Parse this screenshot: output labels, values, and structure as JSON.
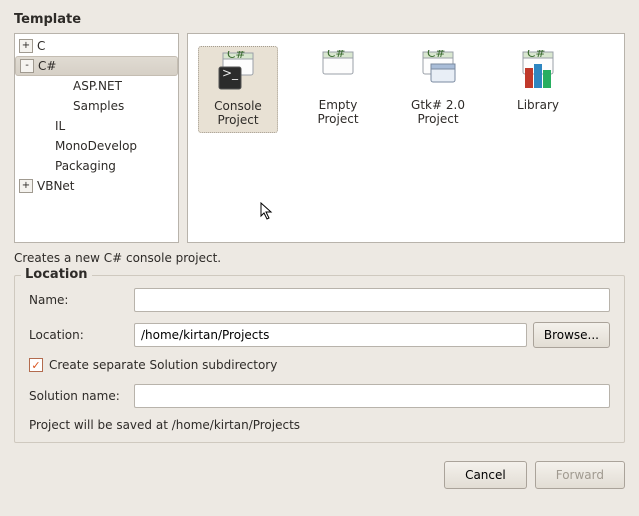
{
  "template_section_label": "Template",
  "tree": {
    "items": [
      {
        "label": "C",
        "expander": "+",
        "indent": 0
      },
      {
        "label": "C#",
        "expander": "-",
        "indent": 0,
        "selected": true
      },
      {
        "label": "ASP.NET",
        "expander": "",
        "indent": 2
      },
      {
        "label": "Samples",
        "expander": "",
        "indent": 2
      },
      {
        "label": "IL",
        "expander": "",
        "indent": 1
      },
      {
        "label": "MonoDevelop",
        "expander": "",
        "indent": 1
      },
      {
        "label": "Packaging",
        "expander": "",
        "indent": 1
      },
      {
        "label": "VBNet",
        "expander": "+",
        "indent": 0
      }
    ]
  },
  "templates": [
    {
      "name": "Console Project",
      "icon": "console",
      "selected": true
    },
    {
      "name": "Empty Project",
      "icon": "empty",
      "selected": false
    },
    {
      "name": "Gtk# 2.0 Project",
      "icon": "gtk",
      "selected": false
    },
    {
      "name": "Library",
      "icon": "library",
      "selected": false
    }
  ],
  "description": "Creates a new C# console project.",
  "location_section_label": "Location",
  "form": {
    "name_label": "Name:",
    "name_value": "",
    "location_label": "Location:",
    "location_value": "/home/kirtan/Projects",
    "browse_label": "Browse...",
    "checkbox_label": "Create separate Solution subdirectory",
    "checkbox_checked": true,
    "solution_name_label": "Solution name:",
    "solution_name_value": "",
    "save_note": "Project will be saved at /home/kirtan/Projects"
  },
  "buttons": {
    "cancel": "Cancel",
    "forward": "Forward"
  }
}
